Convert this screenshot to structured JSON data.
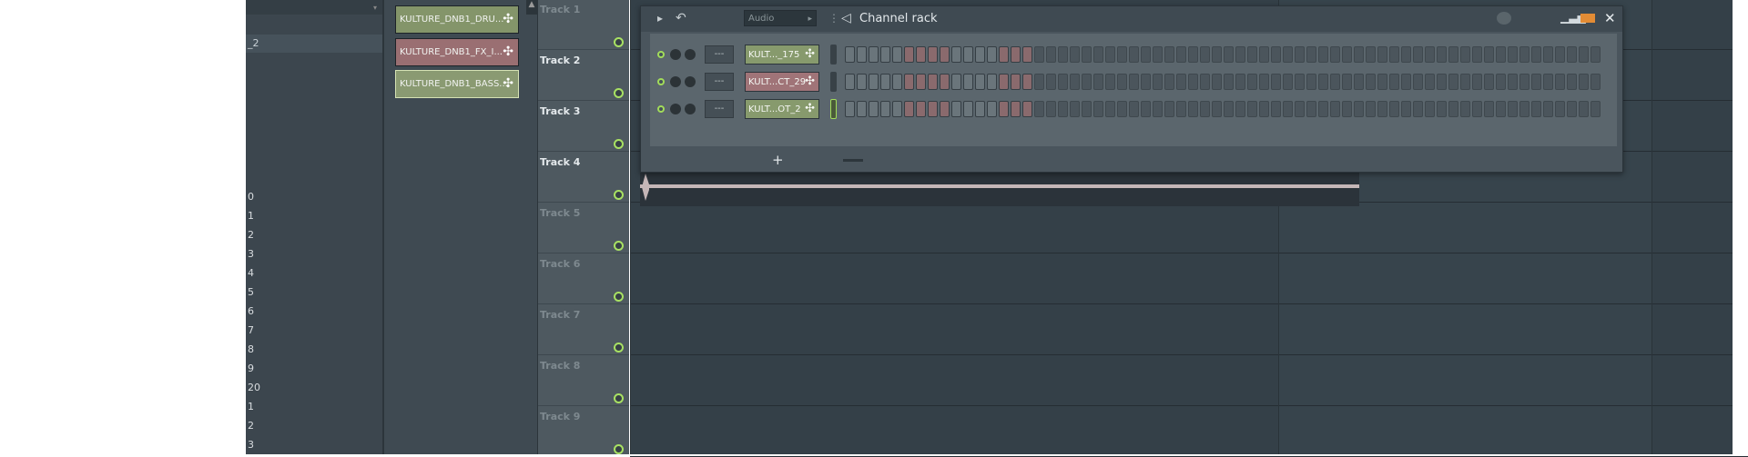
{
  "browser": {
    "selected_suffix": "_2",
    "numbers": [
      "0",
      "1",
      "2",
      "3",
      "4",
      "5",
      "6",
      "7",
      "8",
      "9",
      "20",
      "1",
      "2",
      "3"
    ]
  },
  "picker": {
    "clips": [
      {
        "label": "KULTURE_DNB1_DRU...",
        "color": "green"
      },
      {
        "label": "KULTURE_DNB1_FX_I...",
        "color": "red"
      },
      {
        "label": "KULTURE_DNB1_BASS...",
        "color": "green"
      }
    ]
  },
  "tracks": [
    {
      "name": "Track 1",
      "active": false
    },
    {
      "name": "Track 2",
      "active": true
    },
    {
      "name": "Track 3",
      "active": true
    },
    {
      "name": "Track 4",
      "active": true
    },
    {
      "name": "Track 5",
      "active": false
    },
    {
      "name": "Track 6",
      "active": false
    },
    {
      "name": "Track 7",
      "active": false
    },
    {
      "name": "Track 8",
      "active": false
    },
    {
      "name": "Track 9",
      "active": false
    }
  ],
  "channel_rack": {
    "title": "Channel rack",
    "filter": "Audio",
    "add_label": "+",
    "mixer_track_label": "---",
    "colors": {
      "accent_green": "#a2dc5a",
      "step_red": "#8a6a6d",
      "step_grey": "#6a757b",
      "orange": "#e38c35"
    },
    "channels": [
      {
        "label": "KULT..._175",
        "color": "green",
        "selected": false
      },
      {
        "label": "KULT...CT_29",
        "color": "red",
        "selected": false
      },
      {
        "label": "KULT...OT_2",
        "color": "green",
        "selected": true
      }
    ],
    "steps_visible": 16,
    "steps_total": 64,
    "step_pattern": [
      "g",
      "g",
      "g",
      "g",
      "g",
      "r",
      "r",
      "r",
      "r",
      "g",
      "g",
      "g",
      "g",
      "r",
      "r",
      "r"
    ]
  }
}
